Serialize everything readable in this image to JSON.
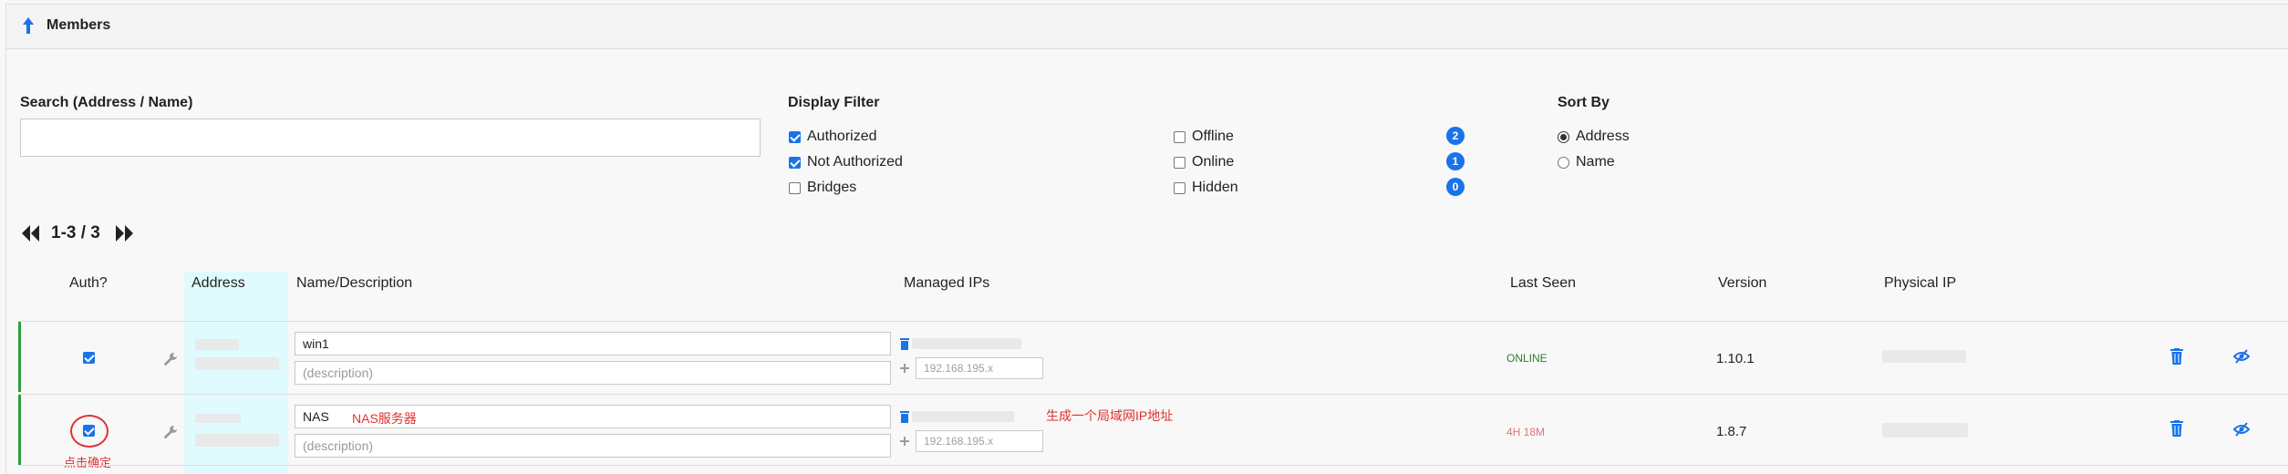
{
  "header": {
    "title": "Members"
  },
  "search": {
    "label": "Search (Address / Name)",
    "value": ""
  },
  "display_filter": {
    "label": "Display Filter",
    "options_left": [
      {
        "label": "Authorized",
        "checked": true
      },
      {
        "label": "Not Authorized",
        "checked": true
      },
      {
        "label": "Bridges",
        "checked": false
      }
    ],
    "options_right": [
      {
        "label": "Offline",
        "checked": false,
        "count": "2"
      },
      {
        "label": "Online",
        "checked": false,
        "count": "1"
      },
      {
        "label": "Hidden",
        "checked": false,
        "count": "0"
      }
    ]
  },
  "sort_by": {
    "label": "Sort By",
    "options": [
      {
        "label": "Address",
        "selected": true
      },
      {
        "label": "Name",
        "selected": false
      }
    ]
  },
  "pager": {
    "range": "1-3 / 3"
  },
  "columns": {
    "auth": "Auth?",
    "address": "Address",
    "name": "Name/Description",
    "managed_ips": "Managed IPs",
    "last_seen": "Last Seen",
    "version": "Version",
    "physical_ip": "Physical IP"
  },
  "members": [
    {
      "authorized": true,
      "name": "win1",
      "description_placeholder": "(description)",
      "ip_placeholder": "192.168.195.x",
      "last_seen": "ONLINE",
      "last_seen_color": "#2e7d32",
      "version": "1.10.1"
    },
    {
      "authorized": true,
      "name": "NAS",
      "description_placeholder": "(description)",
      "ip_placeholder": "192.168.195.x",
      "last_seen": "4H 18M",
      "last_seen_color": "#e57373",
      "version": "1.8.7"
    }
  ],
  "annotations": {
    "nas_note": "NAS服务器",
    "ip_note": "生成一个局域网IP地址",
    "confirm_note": "点击确定"
  },
  "colors": {
    "accent": "#1a73e8",
    "annotation": "#e03131",
    "online_bar": "#2e9e3e",
    "address_highlight": "#e0fbfd"
  },
  "icons": [
    "arrow-up-icon",
    "first-page-icon",
    "last-page-icon",
    "wrench-icon",
    "trash-icon",
    "plus-icon",
    "eye-slash-icon"
  ]
}
